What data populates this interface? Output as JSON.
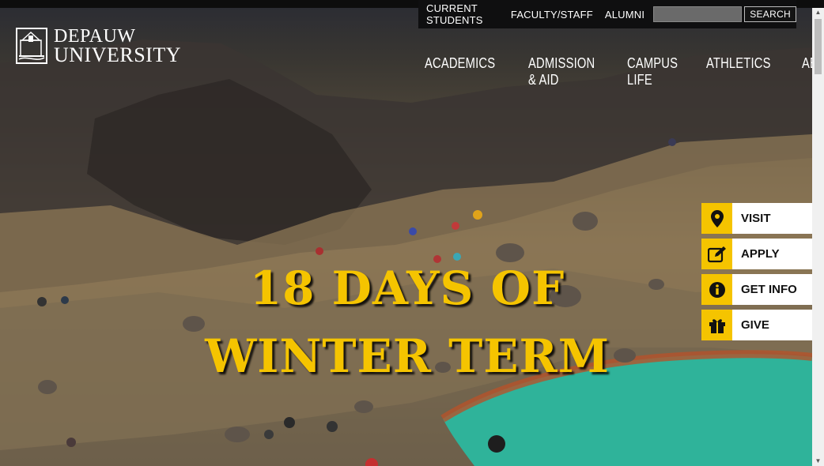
{
  "brand": {
    "line1": "DEPAUW",
    "line2": "UNIVERSITY"
  },
  "utility": {
    "links": [
      "CURRENT STUDENTS",
      "FACULTY/STAFF",
      "ALUMNI"
    ],
    "search_placeholder": "",
    "search_button": "SEARCH"
  },
  "nav": {
    "items": [
      "ACADEMICS",
      "ADMISSION & AID",
      "CAMPUS LIFE",
      "ATHLETICS",
      "ABOUT"
    ]
  },
  "hero": {
    "line1": "18 DAYS OF",
    "line2": "WINTER TERM"
  },
  "actions": [
    {
      "label": "VISIT",
      "icon": "map-pin-icon"
    },
    {
      "label": "APPLY",
      "icon": "edit-icon"
    },
    {
      "label": "GET INFO",
      "icon": "info-icon"
    },
    {
      "label": "GIVE",
      "icon": "gift-icon"
    }
  ],
  "colors": {
    "accent": "#f5c400",
    "header_bg": "#0f0f10",
    "lake": "#2fb39a"
  }
}
